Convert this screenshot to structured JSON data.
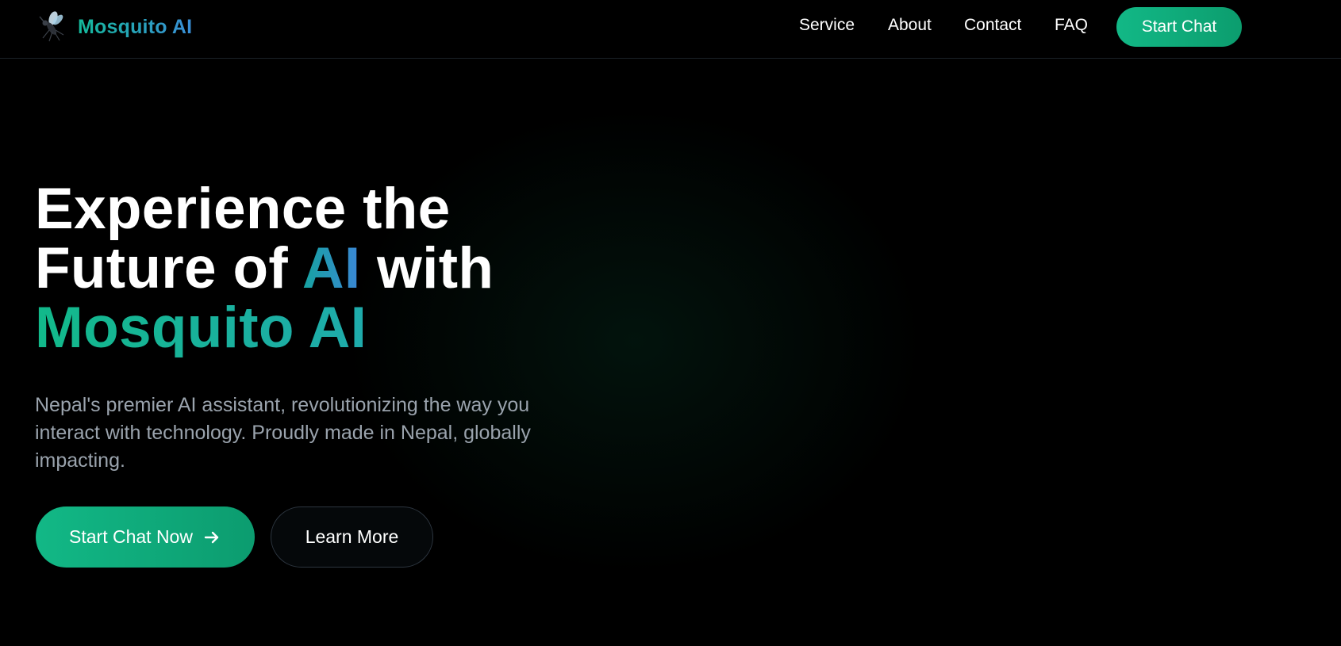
{
  "brand": {
    "name": "Mosquito AI",
    "icon": "mosquito-icon"
  },
  "nav": {
    "links": [
      {
        "label": "Service"
      },
      {
        "label": "About"
      },
      {
        "label": "Contact"
      },
      {
        "label": "FAQ"
      }
    ],
    "cta_label": "Start Chat"
  },
  "hero": {
    "title_line1": "Experience the",
    "title_line2_prefix": "Future of ",
    "title_line2_highlight": "AI",
    "title_line2_suffix": " with",
    "title_line3": "Mosquito AI",
    "subtitle": "Nepal's premier AI assistant, revolutionizing the way you interact with technology. Proudly made in Nepal, globally impacting.",
    "primary_button": "Start Chat Now",
    "primary_button_icon": "arrow-right-icon",
    "secondary_button": "Learn More"
  },
  "colors": {
    "accent_green": "#12b886",
    "accent_blue": "#3b86d6",
    "background": "#000000",
    "subtitle_gray": "#9aa3ad"
  }
}
